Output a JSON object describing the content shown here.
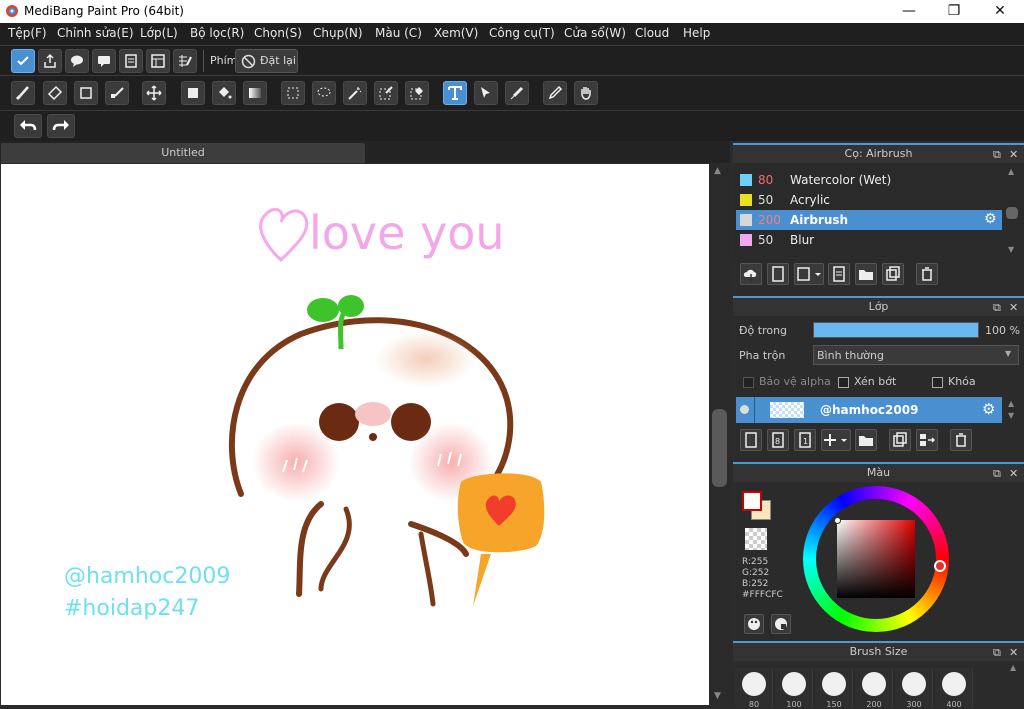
{
  "window": {
    "title": "MediBang Paint Pro (64bit)",
    "minimize": "—",
    "maximize": "❐",
    "close": "✕"
  },
  "menu": [
    "Tệp(F)",
    "Chỉnh sửa(E)",
    "Lớp(L)",
    "Bộ lọc(R)",
    "Chọn(S)",
    "Chụp(N)",
    "Màu (C)",
    "Xem(V)",
    "Công cụ(T)",
    "Cửa sổ(W)",
    "Cloud",
    "Help"
  ],
  "toolbar": {
    "phim_label": "Phím",
    "reset_label": "Đặt lại"
  },
  "tabs": {
    "document": "Untitled"
  },
  "canvas": {
    "title_text": "love you",
    "handle1": "@hamhoc2009",
    "handle2": "#hoidap247"
  },
  "brush_panel": {
    "title": "Cọ: Airbrush",
    "items": [
      {
        "size": "80",
        "name": "Watercolor (Wet)",
        "color": "#6fd0f5"
      },
      {
        "size": "50",
        "name": "Acrylic",
        "color": "#e8e020"
      },
      {
        "size": "200",
        "name": "Airbrush",
        "color": "#d8d8d8",
        "selected": true
      },
      {
        "size": "50",
        "name": "Blur",
        "color": "#f0a8f0"
      }
    ]
  },
  "layer_panel": {
    "title": "Lớp",
    "opacity_label": "Độ trong",
    "opacity_value": "100 %",
    "opacity_fraction": 1.0,
    "blend_label": "Pha trộn",
    "blend_value": "Bình thường",
    "protect_alpha": "Bảo vệ alpha",
    "clipping": "Xén bớt",
    "lock": "Khóa",
    "layer_name": "@hamhoc2009"
  },
  "color_panel": {
    "title": "Màu",
    "r": "R:255",
    "g": "G:252",
    "b": "B:252",
    "hex": "#FFFCFC",
    "fg_color": "#FFFCFC",
    "bg_color": "#F7E6C0"
  },
  "brush_size_panel": {
    "title": "Brush Size",
    "sizes": [
      "80",
      "100",
      "150",
      "200",
      "300",
      "400"
    ]
  }
}
